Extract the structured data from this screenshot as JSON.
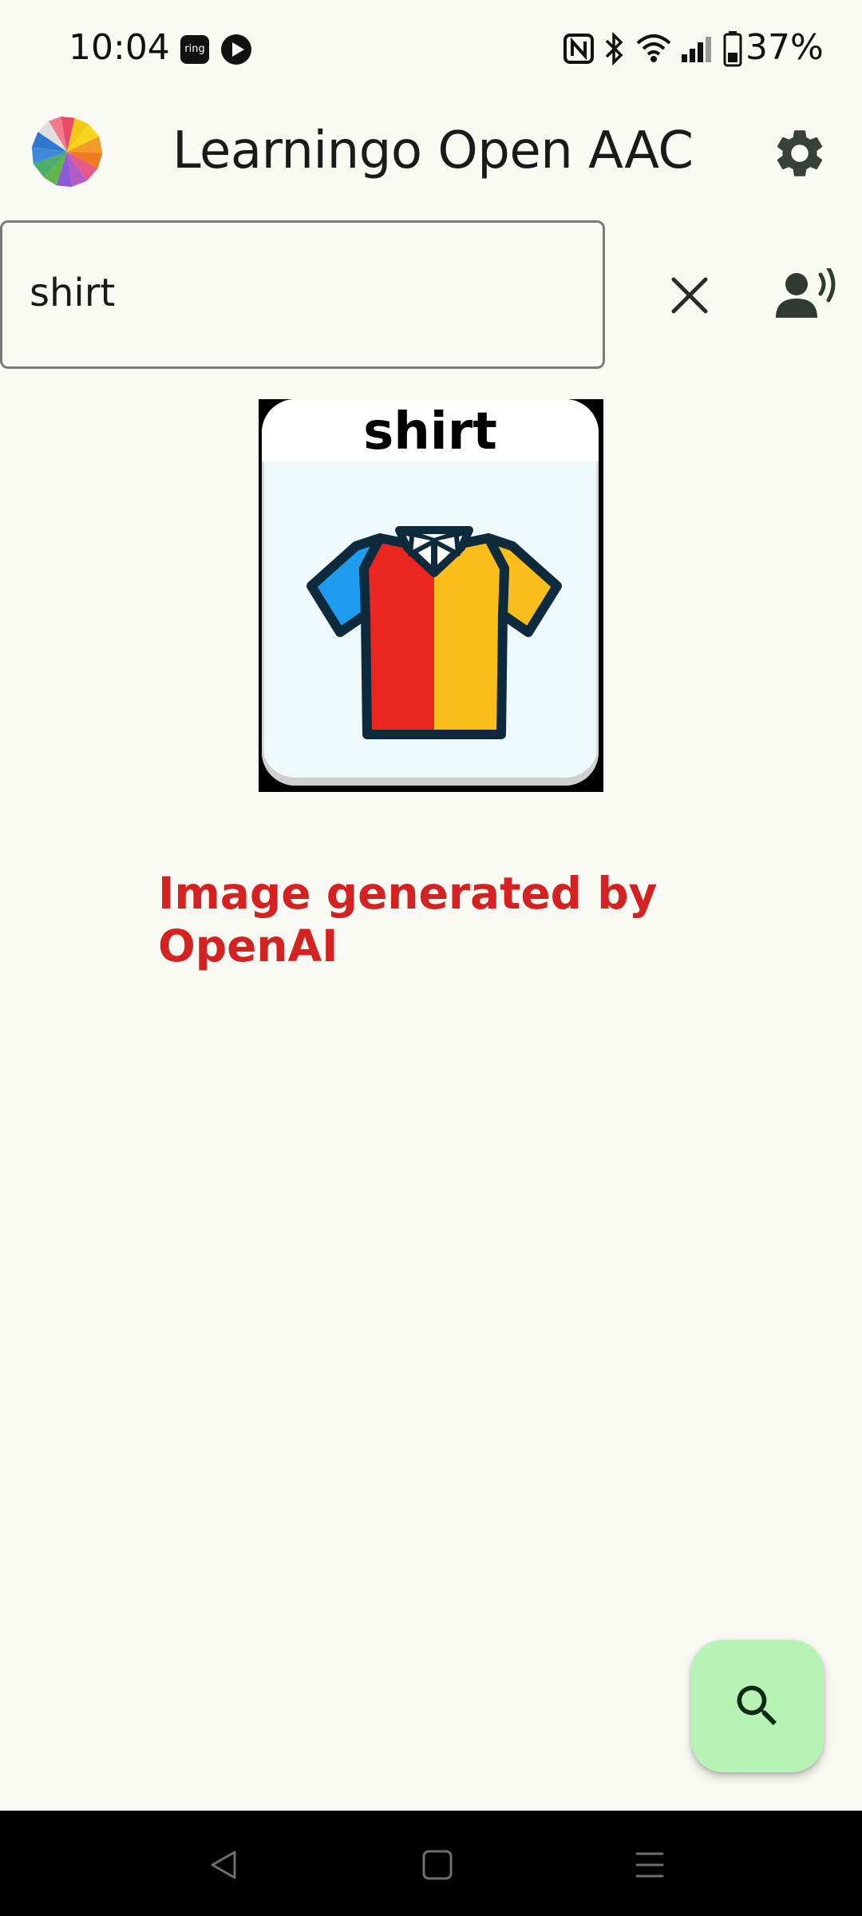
{
  "status_bar": {
    "time": "10:04",
    "ring_label": "ring",
    "battery": "37%",
    "icons": [
      "ring-app-icon",
      "play-icon",
      "nfc-icon",
      "bluetooth-icon",
      "wifi-icon",
      "signal-icon",
      "battery-icon"
    ]
  },
  "app_bar": {
    "title": "Learningo Open AAC",
    "logo_icon": "pinwheel-logo-icon",
    "settings_icon": "gear-icon"
  },
  "search": {
    "value": "shirt",
    "clear_icon": "close-icon",
    "speak_icon": "speak-voice-icon"
  },
  "result_card": {
    "label": "shirt",
    "image_icon": "shirt-icon"
  },
  "attribution": {
    "text": "Image generated by OpenAI",
    "color": "#d42121"
  },
  "fab": {
    "icon": "search-icon",
    "color": "#b8f3b6"
  },
  "nav_bar": {
    "icons": [
      "back-icon",
      "home-icon",
      "recents-icon"
    ]
  }
}
